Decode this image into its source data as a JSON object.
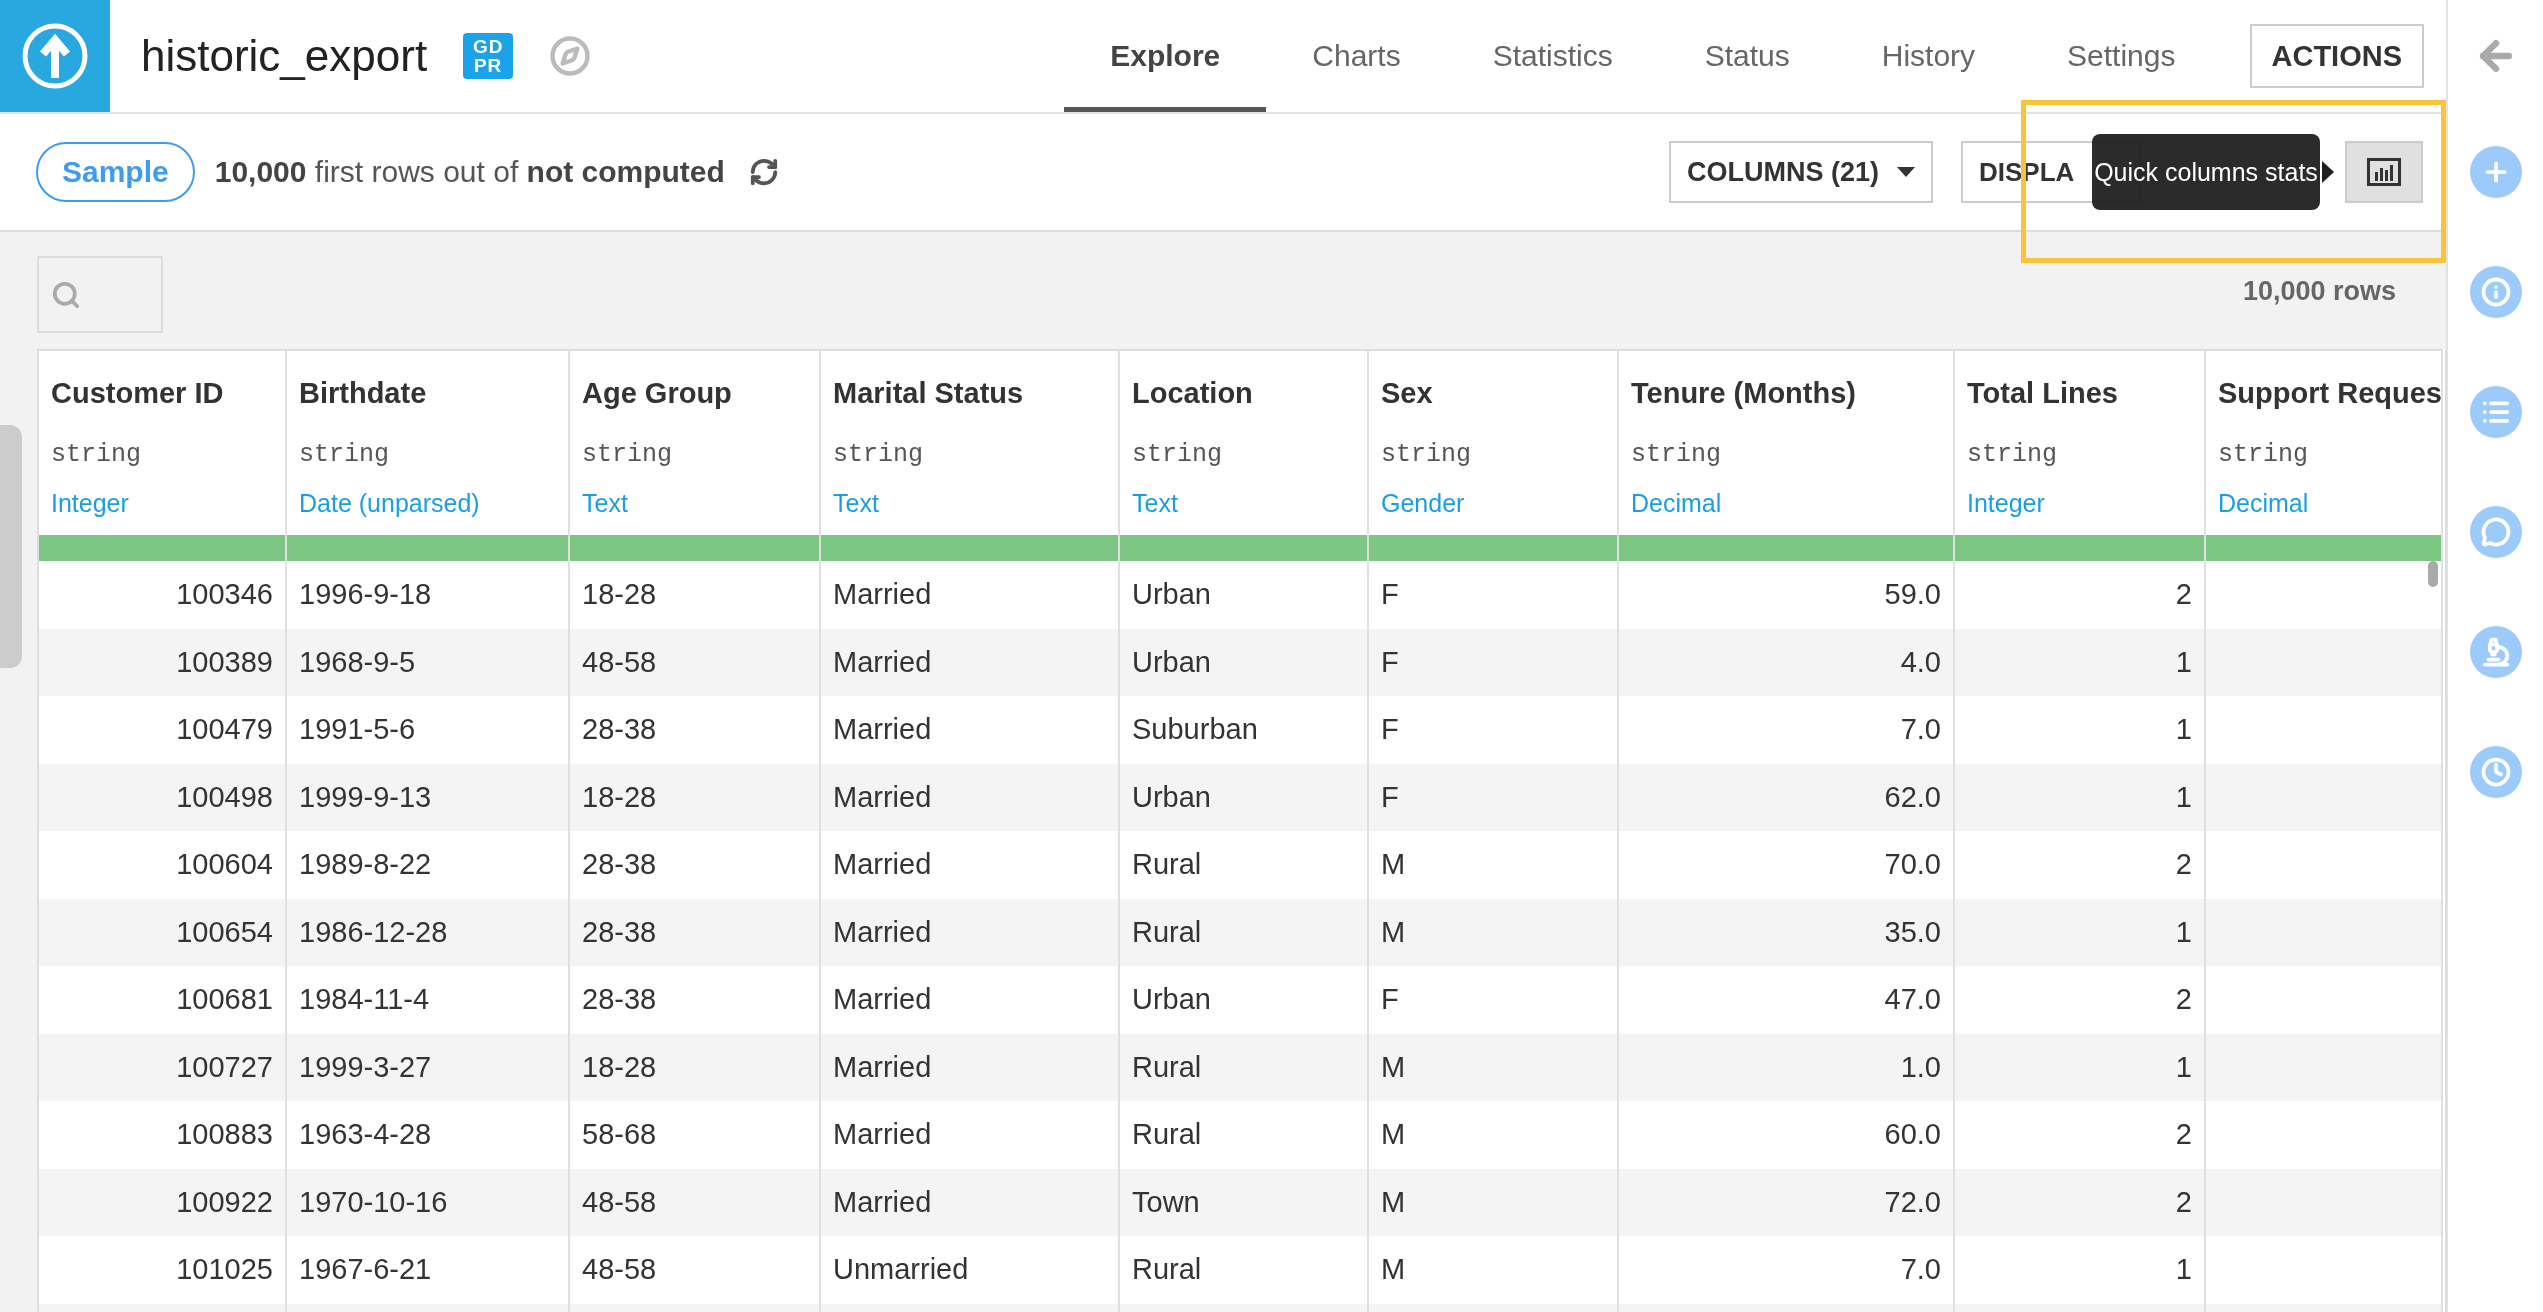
{
  "header": {
    "title": "historic_export",
    "badge": [
      "GD",
      "PR"
    ],
    "tabs": [
      {
        "label": "Explore",
        "selected": true
      },
      {
        "label": "Charts",
        "selected": false
      },
      {
        "label": "Statistics",
        "selected": false
      },
      {
        "label": "Status",
        "selected": false
      },
      {
        "label": "History",
        "selected": false
      },
      {
        "label": "Settings",
        "selected": false
      }
    ],
    "actions_button": "ACTIONS"
  },
  "toolbar": {
    "sample_button": "Sample",
    "sample_info": "**10,000** first rows out of **not computed**",
    "columns_button": "COLUMNS (21)",
    "display_button": "DISPLA",
    "tooltip": "Quick columns stats",
    "quick_stats_selected": true
  },
  "row_count": "10,000 rows",
  "table": {
    "columns": [
      {
        "name": "Customer ID",
        "storage": "string",
        "meaning": "Integer",
        "kind": "number",
        "level": 1
      },
      {
        "name": "Birthdate",
        "storage": "string",
        "meaning": "Date (unparsed)",
        "kind": "text",
        "level": 1
      },
      {
        "name": "Age Group",
        "storage": "string",
        "meaning": "Text",
        "kind": "text",
        "level": 1
      },
      {
        "name": "Marital Status",
        "storage": "string",
        "meaning": "Text",
        "kind": "text",
        "level": 1
      },
      {
        "name": "Location",
        "storage": "string",
        "meaning": "Text",
        "kind": "text",
        "level": 1
      },
      {
        "name": "Sex",
        "storage": "string",
        "meaning": "Gender",
        "kind": "text",
        "level": 1
      },
      {
        "name": "Tenure (Months)",
        "storage": "string",
        "meaning": "Decimal",
        "kind": "number",
        "level": 1
      },
      {
        "name": "Total Lines",
        "storage": "string",
        "meaning": "Integer",
        "kind": "number",
        "level": 1
      },
      {
        "name": "Support Reques",
        "storage": "string",
        "meaning": "Decimal",
        "kind": "number",
        "level": 1
      }
    ],
    "rows": [
      [
        "100346",
        "1996-9-18",
        "18-28",
        "Married",
        "Urban",
        "F",
        "59.0",
        "2"
      ],
      [
        "100389",
        "1968-9-5",
        "48-58",
        "Married",
        "Urban",
        "F",
        "4.0",
        "1"
      ],
      [
        "100479",
        "1991-5-6",
        "28-38",
        "Married",
        "Suburban",
        "F",
        "7.0",
        "1"
      ],
      [
        "100498",
        "1999-9-13",
        "18-28",
        "Married",
        "Urban",
        "F",
        "62.0",
        "1"
      ],
      [
        "100604",
        "1989-8-22",
        "28-38",
        "Married",
        "Rural",
        "M",
        "70.0",
        "2"
      ],
      [
        "100654",
        "1986-12-28",
        "28-38",
        "Married",
        "Rural",
        "M",
        "35.0",
        "1"
      ],
      [
        "100681",
        "1984-11-4",
        "28-38",
        "Married",
        "Urban",
        "F",
        "47.0",
        "2"
      ],
      [
        "100727",
        "1999-3-27",
        "18-28",
        "Married",
        "Rural",
        "M",
        "1.0",
        "1"
      ],
      [
        "100883",
        "1963-4-28",
        "58-68",
        "Married",
        "Rural",
        "M",
        "60.0",
        "2"
      ],
      [
        "100922",
        "1970-10-16",
        "48-58",
        "Married",
        "Town",
        "M",
        "72.0",
        "2"
      ],
      [
        "101025",
        "1967-6-21",
        "48-58",
        "Unmarried",
        "Rural",
        "M",
        "7.0",
        "1"
      ]
    ]
  }
}
